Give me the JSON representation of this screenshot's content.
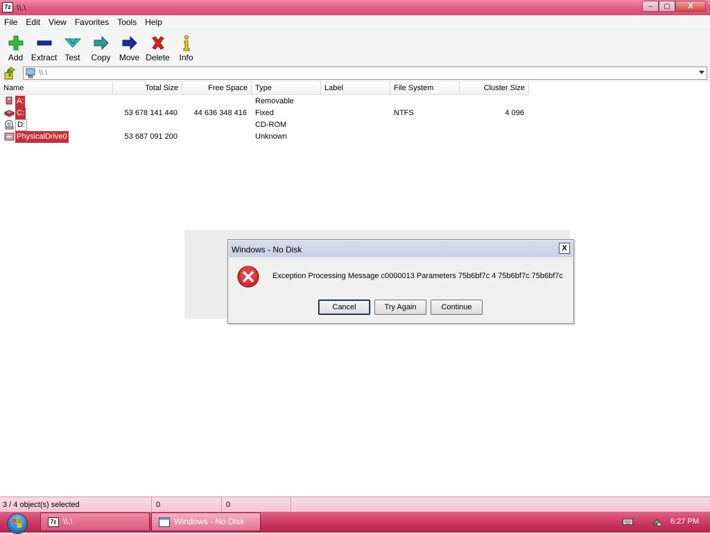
{
  "window": {
    "title": "\\\\.\\",
    "app_icon": "7z"
  },
  "window_controls": {
    "minimize": "–",
    "maximize": "▢",
    "close": "X"
  },
  "menu": [
    "File",
    "Edit",
    "View",
    "Favorites",
    "Tools",
    "Help"
  ],
  "toolbar": [
    {
      "label": "Add",
      "icon": "add-icon"
    },
    {
      "label": "Extract",
      "icon": "extract-icon"
    },
    {
      "label": "Test",
      "icon": "test-icon"
    },
    {
      "label": "Copy",
      "icon": "copy-icon"
    },
    {
      "label": "Move",
      "icon": "move-icon"
    },
    {
      "label": "Delete",
      "icon": "delete-icon"
    },
    {
      "label": "Info",
      "icon": "info-icon"
    }
  ],
  "address": {
    "value": "\\\\.\\"
  },
  "columns": [
    "Name",
    "Total Size",
    "Free Space",
    "Type",
    "Label",
    "File System",
    "Cluster Size"
  ],
  "rows": [
    {
      "name": "A:",
      "total": "",
      "free": "",
      "type": "Removable",
      "label": "",
      "fs": "",
      "cluster": "",
      "selected": true
    },
    {
      "name": "C:",
      "total": "53 678 141 440",
      "free": "44 636 348 416",
      "type": "Fixed",
      "label": "",
      "fs": "NTFS",
      "cluster": "4 096",
      "selected": true
    },
    {
      "name": "D:",
      "total": "",
      "free": "",
      "type": "CD-ROM",
      "label": "",
      "fs": "",
      "cluster": "",
      "selected": false
    },
    {
      "name": "PhysicalDrive0",
      "total": "53 687 091 200",
      "free": "",
      "type": "Unknown",
      "label": "",
      "fs": "",
      "cluster": "",
      "selected": true
    }
  ],
  "dialog": {
    "title": "Windows - No Disk",
    "close": "X",
    "message": "Exception Processing Message c0000013 Parameters 75b6bf7c 4 75b6bf7c 75b6bf7c",
    "buttons": [
      "Cancel",
      "Try Again",
      "Continue"
    ]
  },
  "status": {
    "selection": "3 / 4 object(s) selected",
    "size": "0",
    "packed": "0"
  },
  "taskbar": {
    "tasks": [
      {
        "label": "\\\\.\\",
        "active": false
      },
      {
        "label": "Windows - No Disk",
        "active": true
      }
    ],
    "clock": "6:27 PM"
  },
  "colors": {
    "selection": "#c92f39",
    "titlebar": "#e05a83",
    "taskbar": "#c9335f",
    "error": "#d42a2a"
  }
}
